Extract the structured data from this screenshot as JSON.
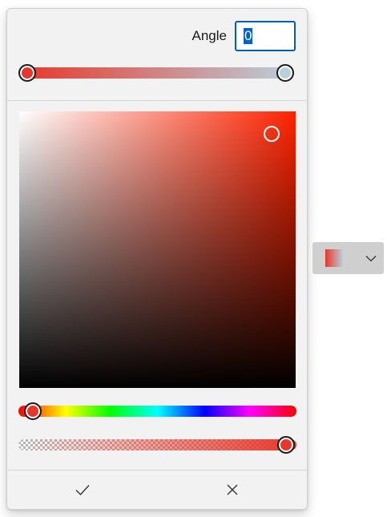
{
  "color_picker": {
    "angle_label": "Angle",
    "angle_value": "0",
    "gradient": {
      "start_color": "#e8372a",
      "end_color": "#b9d0dc"
    },
    "spectrum": {
      "hue_color": "#ff2200"
    },
    "hue_value_percent": 5,
    "alpha_value_percent": 100
  },
  "footer": {
    "confirm_icon": "checkmark-icon",
    "cancel_icon": "close-icon"
  },
  "picker_button": {
    "swatch_gradient": [
      "#e8372a",
      "#b9d0dc"
    ],
    "dropdown_icon": "chevron-down-icon"
  }
}
